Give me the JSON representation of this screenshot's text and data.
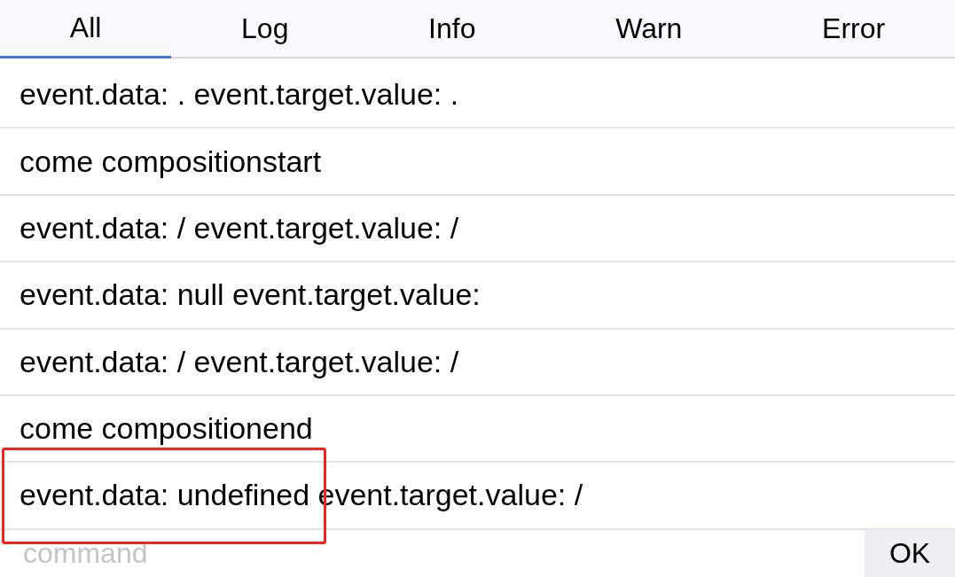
{
  "tabs": [
    {
      "label": "All",
      "selected": true
    },
    {
      "label": "Log",
      "selected": false
    },
    {
      "label": "Info",
      "selected": false
    },
    {
      "label": "Warn",
      "selected": false
    },
    {
      "label": "Error",
      "selected": false
    }
  ],
  "log_entries": [
    "event.data: . event.target.value: .",
    "come compositionstart",
    "event.data: / event.target.value: /",
    "event.data: null event.target.value:",
    "event.data: / event.target.value: /",
    "come compositionend",
    "event.data: undefined event.target.value: /"
  ],
  "command_bar": {
    "placeholder": "command",
    "button": "OK"
  },
  "annotation": {
    "kind": "rectangle"
  }
}
